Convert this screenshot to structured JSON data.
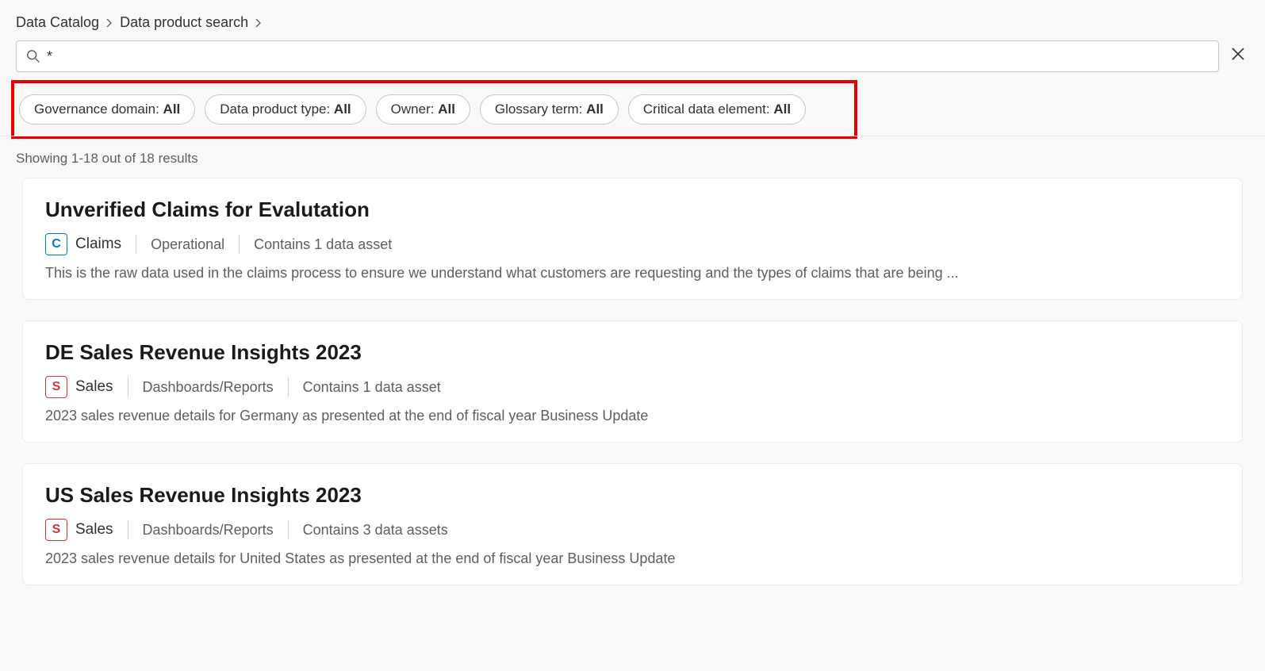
{
  "breadcrumb": {
    "items": [
      "Data Catalog",
      "Data product search"
    ]
  },
  "search": {
    "value": "*",
    "close_label": "Clear"
  },
  "filters": [
    {
      "label": "Governance domain:",
      "value": "All"
    },
    {
      "label": "Data product type:",
      "value": "All"
    },
    {
      "label": "Owner:",
      "value": "All"
    },
    {
      "label": "Glossary term:",
      "value": "All"
    },
    {
      "label": "Critical data element:",
      "value": "All"
    }
  ],
  "results_summary": "Showing 1-18 out of 18 results",
  "domain_styles": {
    "Claims": {
      "letter": "C",
      "border": "#0078d4",
      "color": "#0078d4"
    },
    "Sales": {
      "letter": "S",
      "border": "#d13438",
      "color": "#d13438"
    }
  },
  "results": [
    {
      "title": "Unverified Claims for Evalutation",
      "domain": "Claims",
      "type": "Operational",
      "assets": "Contains 1 data asset",
      "description": "This is the raw data used in the claims process to ensure we understand what customers are requesting and the types of claims that are being ..."
    },
    {
      "title": "DE Sales Revenue Insights 2023",
      "domain": "Sales",
      "type": "Dashboards/Reports",
      "assets": "Contains 1 data asset",
      "description": "2023 sales revenue details for Germany as presented at the end of fiscal year Business Update"
    },
    {
      "title": "US Sales Revenue Insights 2023",
      "domain": "Sales",
      "type": "Dashboards/Reports",
      "assets": "Contains 3 data assets",
      "description": "2023 sales revenue details for United States as presented at the end of fiscal year Business Update"
    }
  ]
}
